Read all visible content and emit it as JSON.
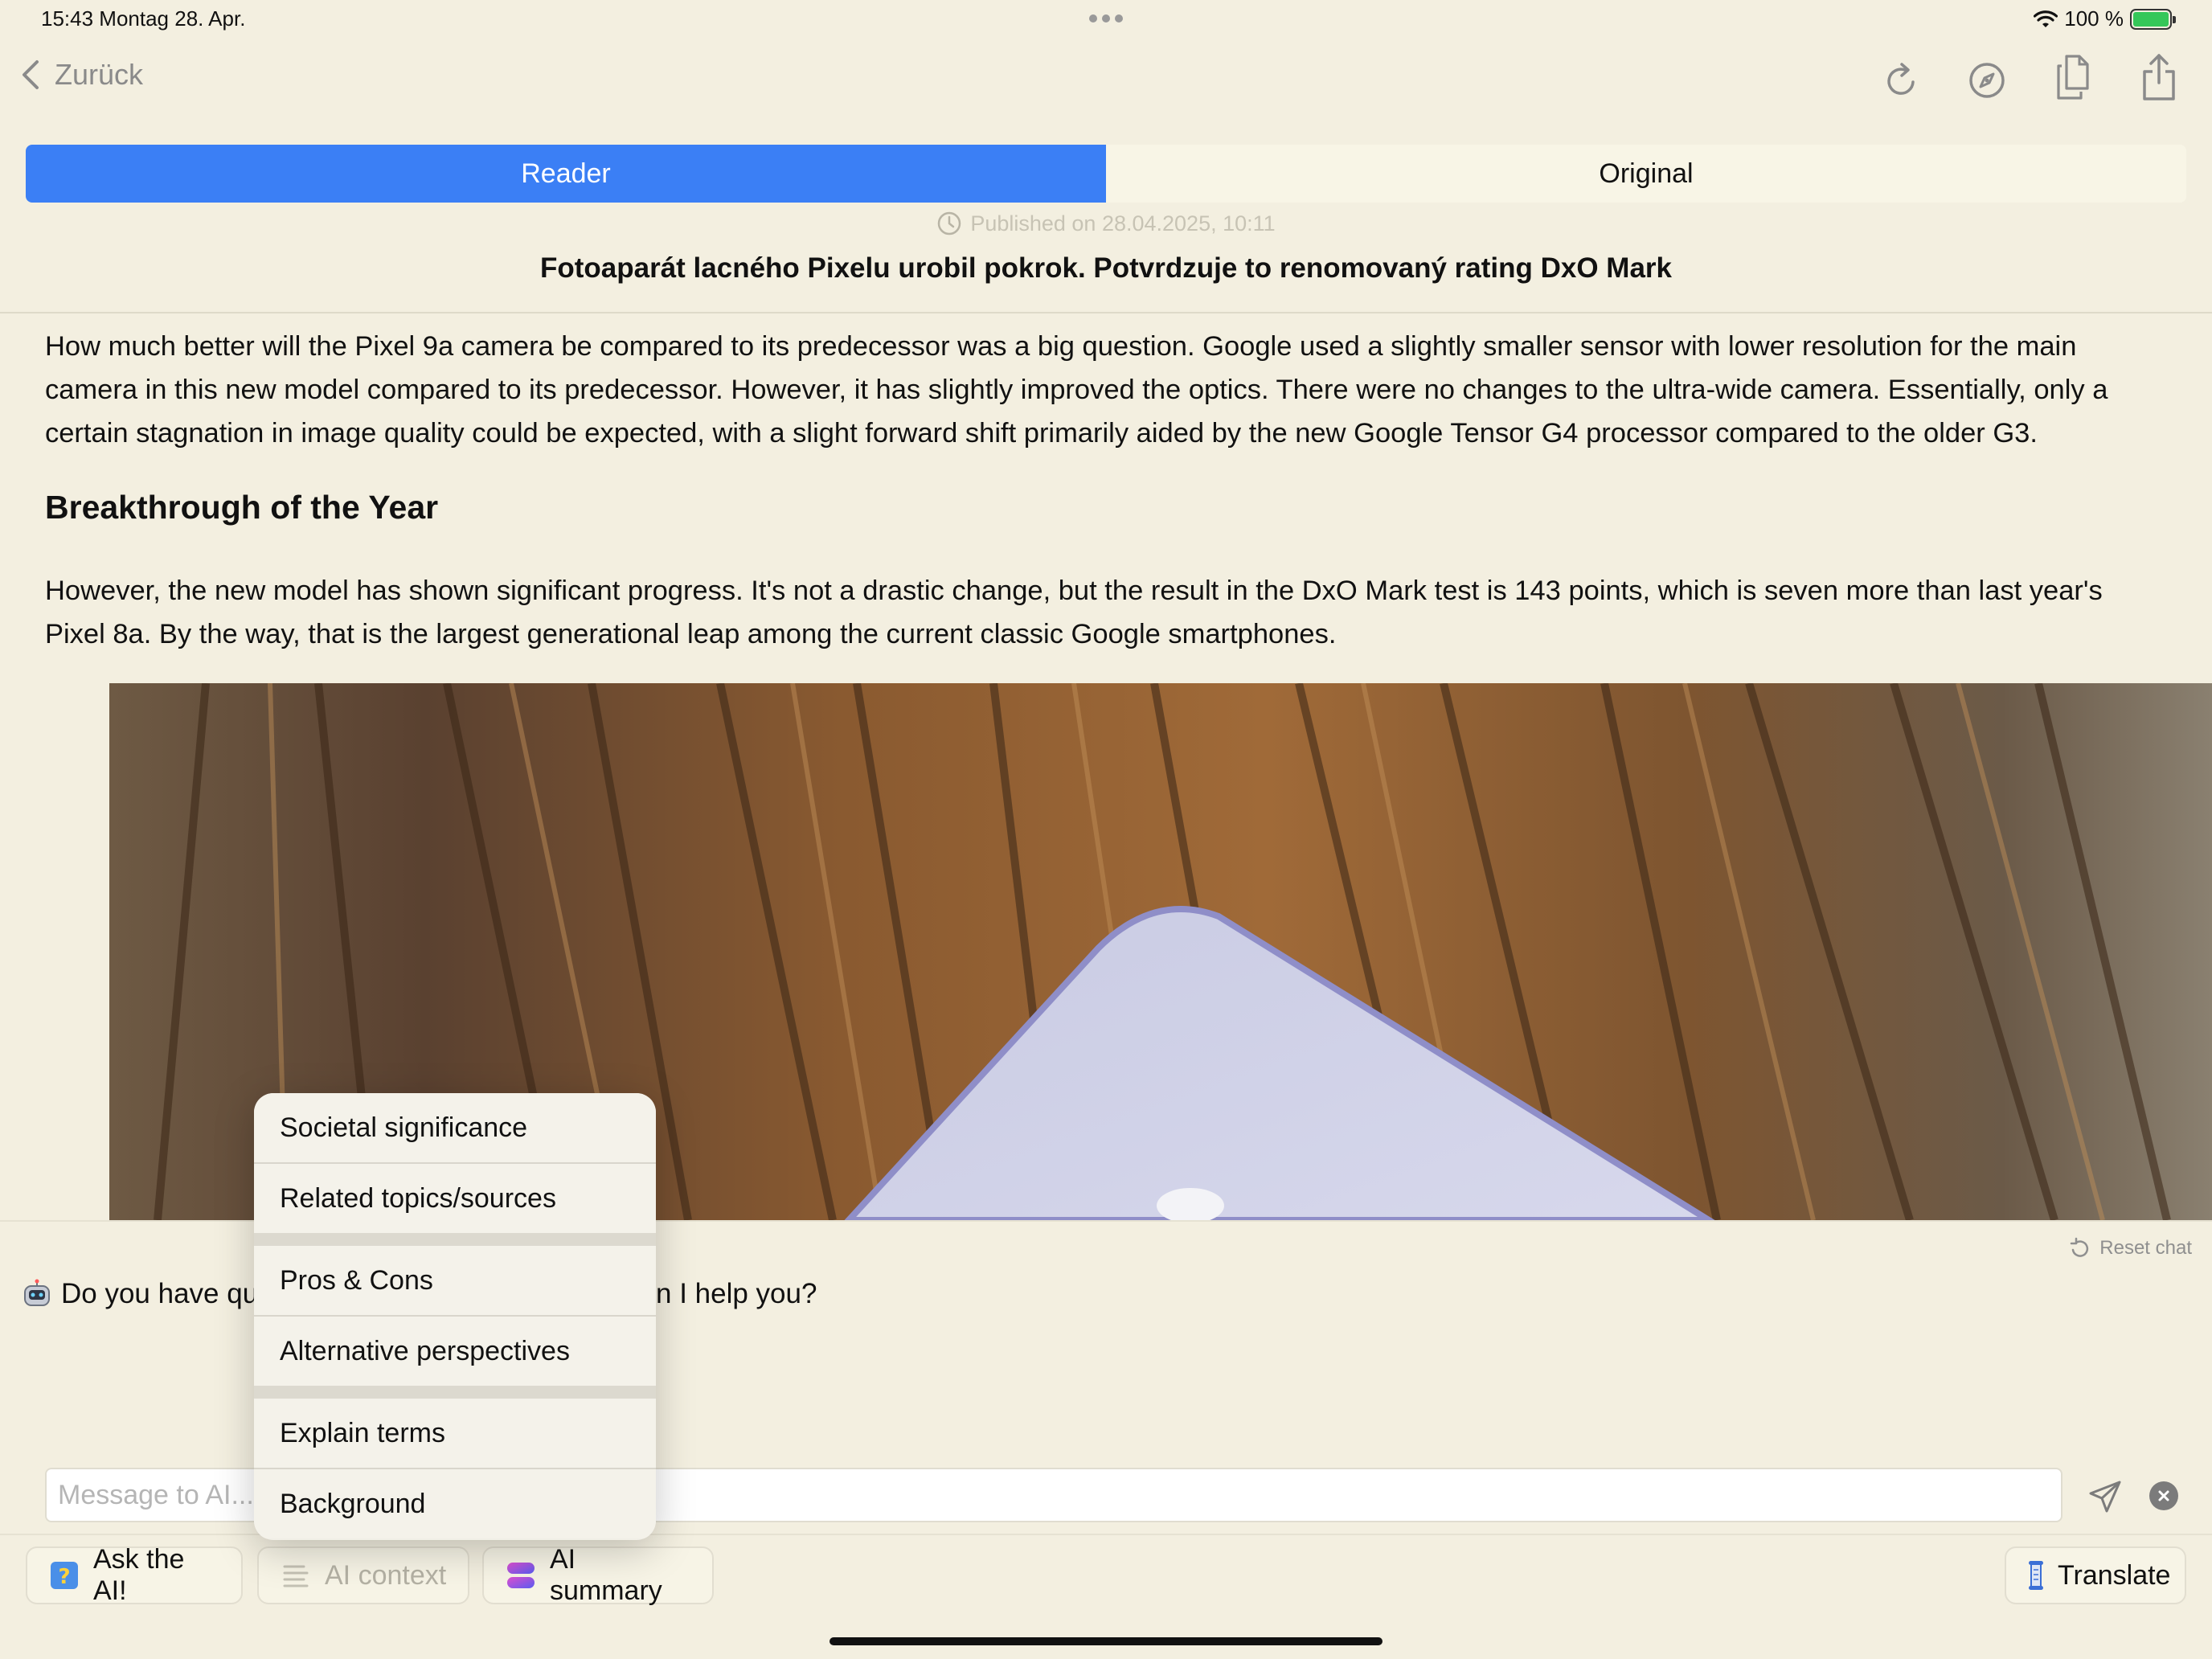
{
  "status_bar": {
    "time_date": "15:43   Montag 28. Apr.",
    "battery": "100 %",
    "battery_level": 1.0
  },
  "nav": {
    "back_label": "Zurück",
    "icons": [
      "reload-icon",
      "compass-icon",
      "copy-icon",
      "share-icon"
    ]
  },
  "tabs": {
    "reader": "Reader",
    "original": "Original",
    "active": "Reader"
  },
  "article": {
    "published": "Published on 28.04.2025, 10:11",
    "title": "Fotoaparát lacného Pixelu urobil pokrok. Potvrdzuje to renomovaný rating DxO Mark",
    "paragraph1": "How much better will the Pixel 9a camera be compared to its predecessor was a big question. Google used a slightly smaller sensor with lower resolution for the main camera in this new model compared to its predecessor. However, it has slightly improved the optics. There were no changes to the ultra-wide camera. Essentially, only a certain stagnation in image quality could be expected, with a slight forward shift primarily aided by the new Google Tensor G4 processor compared to the older G3.",
    "heading": "Breakthrough of the Year",
    "paragraph2": "However, the new model has shown significant progress. It's not a drastic change, but the result in the DxO Mark test is 143 points, which is seven more than last year's Pixel 8a. By the way, that is the largest generational leap among the current classic Google smartphones."
  },
  "chat": {
    "reset_label": "Reset chat",
    "message_visible_left": "Do you have qu",
    "message_visible_right": "n I help you?",
    "input_placeholder": "Message to AI..."
  },
  "menu": {
    "items": [
      "Societal significance",
      "Related topics/sources",
      "Pros & Cons",
      "Alternative perspectives",
      "Explain terms",
      "Background"
    ]
  },
  "toolbar": {
    "ask": "Ask the AI!",
    "context": "AI context",
    "summary": "AI summary",
    "translate": "Translate"
  },
  "colors": {
    "accent": "#3b7ff5",
    "background": "#f3efe0",
    "battery": "#35c759"
  }
}
